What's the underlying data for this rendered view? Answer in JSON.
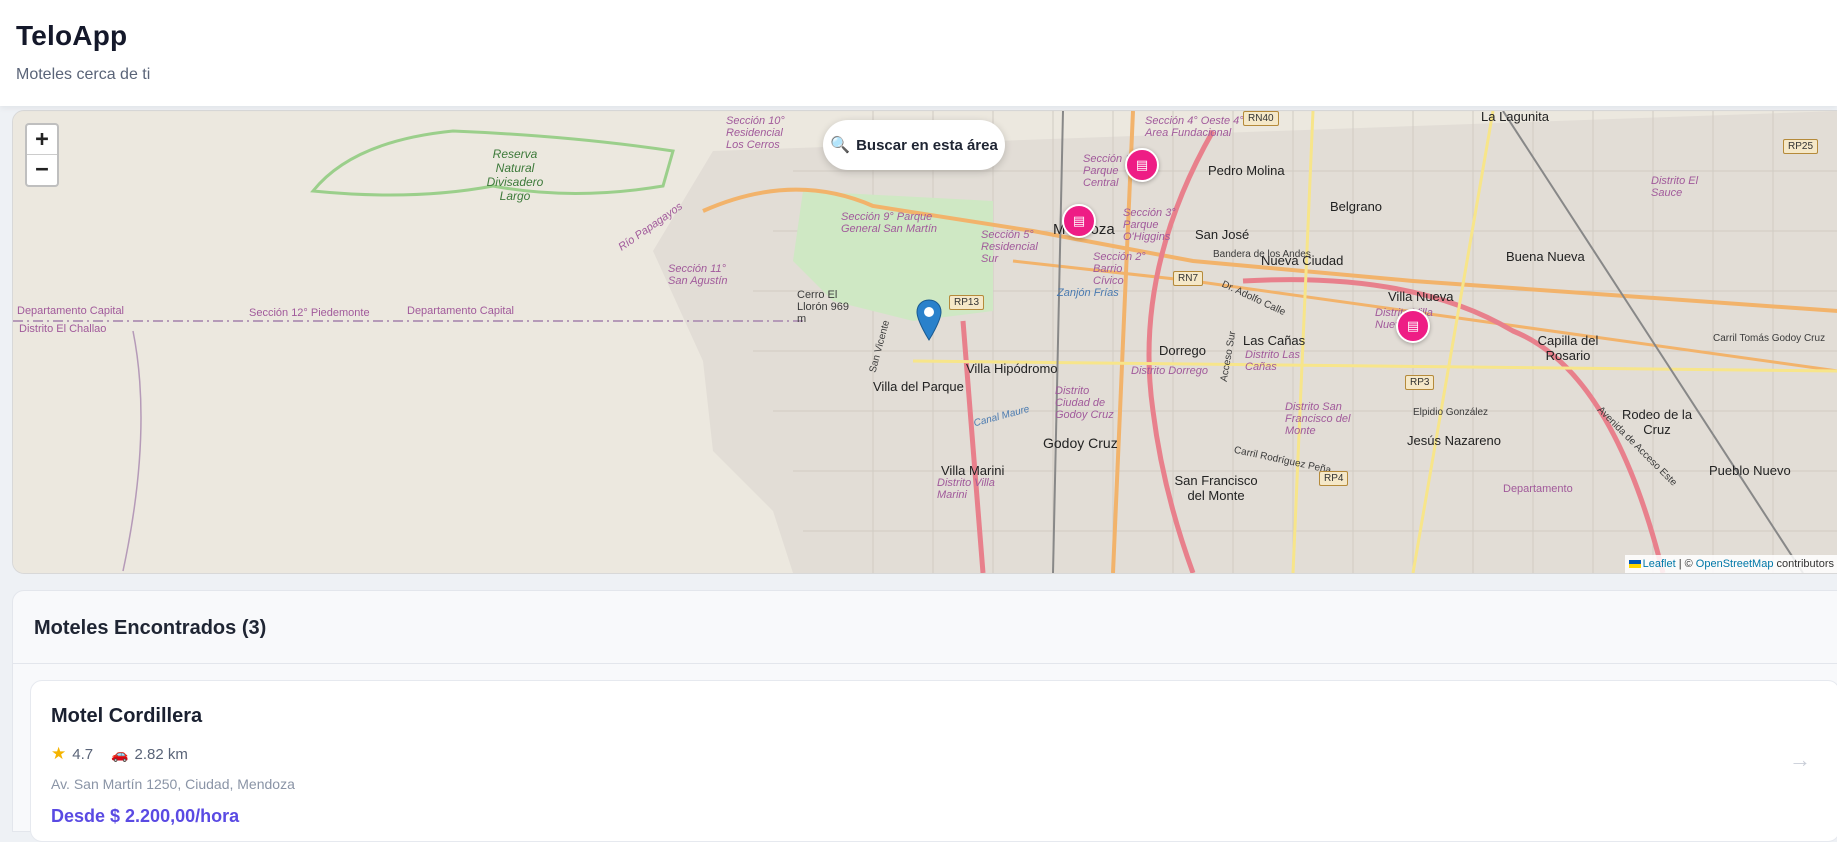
{
  "header": {
    "title": "TeloApp",
    "subtitle": "Moteles cerca de ti"
  },
  "map": {
    "search_area_label": "Buscar en esta área",
    "zoom_in": "+",
    "zoom_out": "−",
    "attribution": {
      "leaflet": "Leaflet",
      "separator": "| ©",
      "osm": "OpenStreetMap",
      "contributors": "contributors"
    },
    "labels": {
      "reserva": "Reserva Natural Divisadero Largo",
      "seccion10": "Sección 10° Residencial Los Cerros",
      "seccion11": "Sección 11° San Agustín",
      "seccion9": "Sección 9° Parque General San Martín",
      "cerro": "Cerro El Llorón 969 m",
      "rio": "Río Papagayos",
      "depto_capital_1": "Departamento Capital",
      "depto_capital_2": "Departamento Capital",
      "seccion12": "Sección 12° Piedemonte",
      "distrito_challao": "Distrito El Challao",
      "mendoza": "Mendoza",
      "seccion5": "Sección 5° Residencial Sur",
      "seccion1": "Sección 1° Parque Central",
      "seccion4": "Sección 4° Oeste 4° Area Fundacional",
      "seccion3": "Sección 3° Parque O'Higgins",
      "seccion2": "Sección 2° Barrio Cívico",
      "zanjon": "Zanjón Frías",
      "pedro_molina": "Pedro Molina",
      "belgrano": "Belgrano",
      "san_jose": "San José",
      "nueva_ciudad": "Nueva Ciudad",
      "la_lagunita": "La Lagunita",
      "distrito_sauce": "Distrito El Sauce",
      "buena_nueva": "Buena Nueva",
      "villa_nueva": "Villa Nueva",
      "distrito_villa_nueva": "Distrito Villa Nueva",
      "capilla": "Capilla del Rosario",
      "las_canas": "Las Cañas",
      "distrito_las_canas": "Distrito Las Cañas",
      "dorrego": "Dorrego",
      "distrito_dorrego": "Distrito Dorrego",
      "villa_hipodromo": "Villa Hipódromo",
      "villa_del_parque": "Villa del Parque",
      "distrito_godoy": "Distrito Ciudad de Godoy Cruz",
      "godoy_cruz": "Godoy Cruz",
      "villa_marini": "Villa Marini",
      "distrito_villa_marini": "Distrito Villa Marini",
      "san_francisco": "San Francisco del Monte",
      "distrito_sf": "Distrito San Francisco del Monte",
      "jesus_nazareno": "Jesús Nazareno",
      "rodeo": "Rodeo de la Cruz",
      "pueblo_nuevo": "Pueblo Nuevo",
      "san_vicente": "San Vicente",
      "canal_maure": "Canal Maure",
      "bandera_andes": "Bandera de los Andes",
      "adolfo_calle": "Dr. Adolfo Calle",
      "acceso_sur": "Acceso Sur",
      "acceso_este": "Avenida de Acceso Este",
      "carril_rodriguez": "Carril Rodríguez Peña",
      "carril_godoy": "Carril Tomás Godoy Cruz",
      "epidio": "Elpidio González",
      "departamento": "Departamento"
    },
    "shields": {
      "rp13": "RP13",
      "rn40": "RN40",
      "rn7": "RN7",
      "rp3": "RP3",
      "rp4": "RP4",
      "rp25": "RP25"
    },
    "motel_marker_icon": "bed-icon",
    "marker_color": "#ee1d85"
  },
  "results": {
    "title": "Moteles Encontrados (3)",
    "motels": [
      {
        "name": "Motel Cordillera",
        "rating": "4.7",
        "distance": "2.82 km",
        "address": "Av. San Martín 1250, Ciudad, Mendoza",
        "price": "Desde $ 2.200,00/hora"
      }
    ]
  },
  "colors": {
    "accent": "#5a4ae3",
    "marker": "#ee1d85"
  }
}
